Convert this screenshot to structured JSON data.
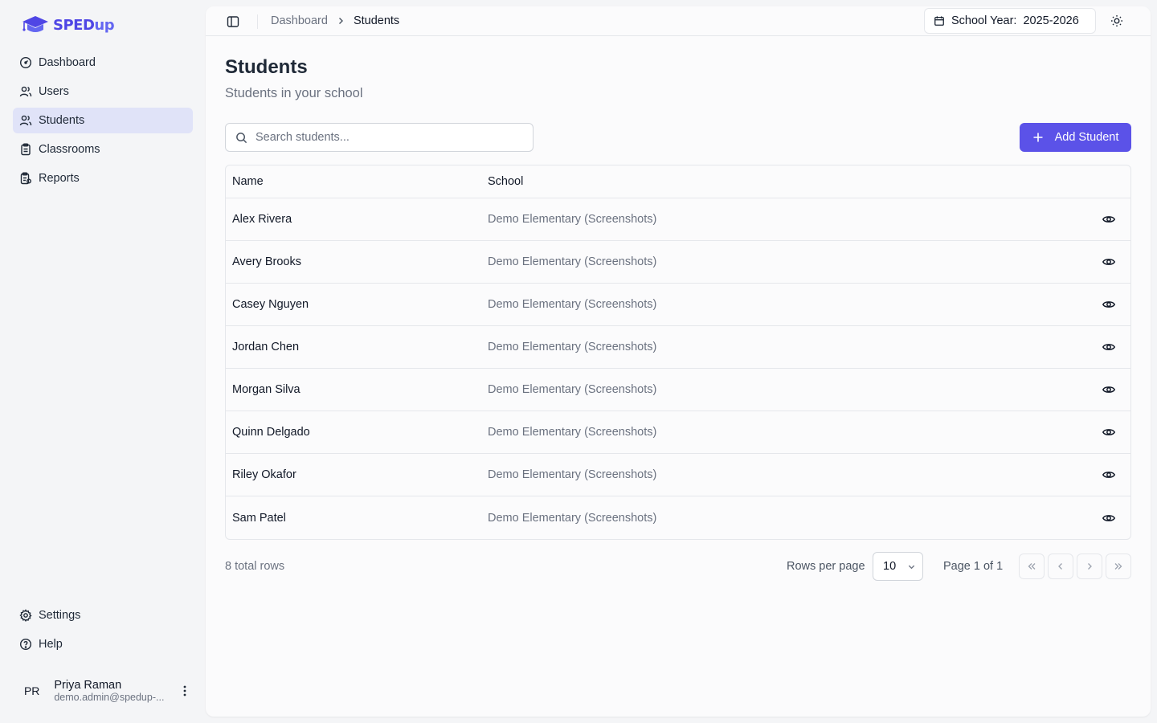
{
  "brand": {
    "name_part1": "SPED",
    "name_part2": "up",
    "accent": "#5b52e8"
  },
  "sidebar": {
    "items": [
      {
        "label": "Dashboard",
        "icon": "gauge-icon",
        "active": false
      },
      {
        "label": "Users",
        "icon": "users-icon",
        "active": false
      },
      {
        "label": "Students",
        "icon": "users-icon",
        "active": true
      },
      {
        "label": "Classrooms",
        "icon": "clipboard-icon",
        "active": false
      },
      {
        "label": "Reports",
        "icon": "report-icon",
        "active": false
      }
    ],
    "bottom_items": [
      {
        "label": "Settings",
        "icon": "gear-icon"
      },
      {
        "label": "Help",
        "icon": "help-circle-icon"
      }
    ],
    "user": {
      "initials": "PR",
      "name": "Priya Raman",
      "email": "demo.admin@spedup-..."
    }
  },
  "topbar": {
    "breadcrumb": {
      "parent": "Dashboard",
      "current": "Students"
    },
    "school_year_label": "School Year:",
    "school_year_value": "2025-2026"
  },
  "page": {
    "title": "Students",
    "subtitle": "Students in your school",
    "search_placeholder": "Search students...",
    "add_button_label": "Add Student"
  },
  "table": {
    "columns": {
      "name": "Name",
      "school": "School"
    },
    "rows": [
      {
        "name": "Alex Rivera",
        "school": "Demo Elementary (Screenshots)"
      },
      {
        "name": "Avery Brooks",
        "school": "Demo Elementary (Screenshots)"
      },
      {
        "name": "Casey Nguyen",
        "school": "Demo Elementary (Screenshots)"
      },
      {
        "name": "Jordan Chen",
        "school": "Demo Elementary (Screenshots)"
      },
      {
        "name": "Morgan Silva",
        "school": "Demo Elementary (Screenshots)"
      },
      {
        "name": "Quinn Delgado",
        "school": "Demo Elementary (Screenshots)"
      },
      {
        "name": "Riley Okafor",
        "school": "Demo Elementary (Screenshots)"
      },
      {
        "name": "Sam Patel",
        "school": "Demo Elementary (Screenshots)"
      }
    ]
  },
  "pagination": {
    "total_rows": "8 total rows",
    "rows_per_page_label": "Rows per page",
    "rows_per_page_value": "10",
    "page_info": "Page 1 of 1"
  }
}
